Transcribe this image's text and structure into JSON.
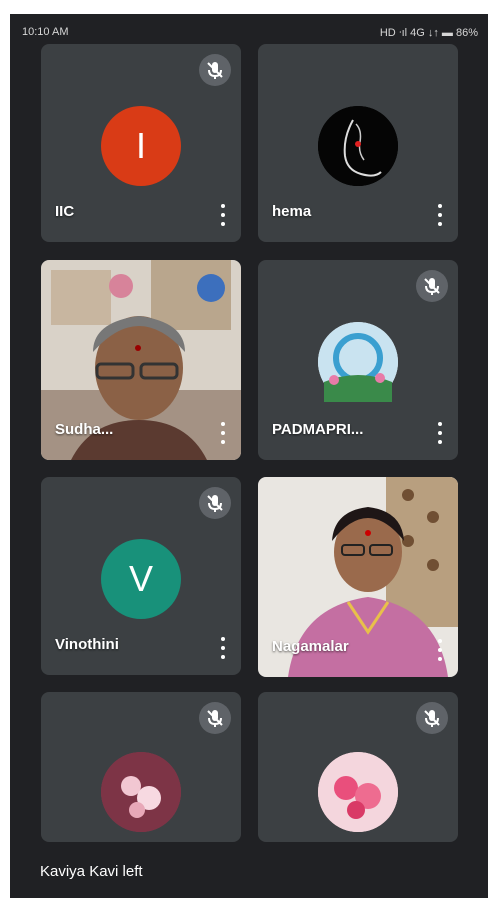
{
  "status": {
    "time": "10:10 AM",
    "indicators": "HD ᐧıl 4G ↓↑ ▬ 86%"
  },
  "tiles": [
    {
      "name": "IIC",
      "avatar_letter": "I",
      "avatar_color": "#d93b16",
      "muted": true
    },
    {
      "name": "hema",
      "muted": false
    },
    {
      "name": "Sudha...",
      "video": true
    },
    {
      "name": "PADMAPRI...",
      "muted": true
    },
    {
      "name": "Vinothini",
      "avatar_letter": "V",
      "avatar_color": "#18917a",
      "muted": true
    },
    {
      "name": "Nagamalar",
      "video": true
    },
    {
      "name": "",
      "muted": true
    },
    {
      "name": "",
      "muted": true
    }
  ],
  "toast": "Kaviya Kavi left",
  "icons": {
    "mute": "mic-off-icon",
    "menu": "more-vert-icon"
  }
}
